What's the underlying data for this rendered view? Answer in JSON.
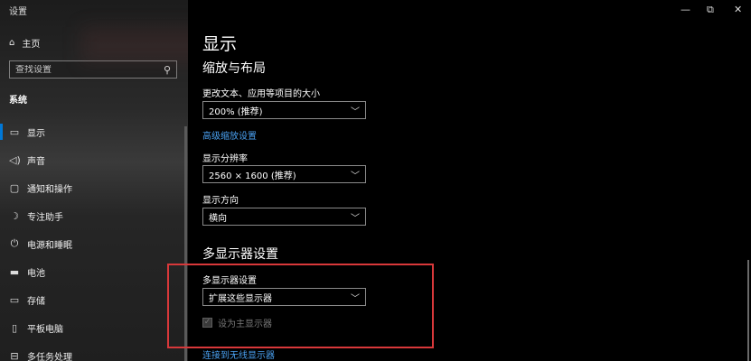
{
  "app": {
    "title": "设置",
    "home": "主页"
  },
  "search": {
    "placeholder": "查找设置"
  },
  "sidebar": {
    "section": "系统",
    "items": [
      {
        "icon": "monitor-icon",
        "label": "显示"
      },
      {
        "icon": "speaker-icon",
        "label": "声音"
      },
      {
        "icon": "notification-icon",
        "label": "通知和操作"
      },
      {
        "icon": "moon-icon",
        "label": "专注助手"
      },
      {
        "icon": "power-icon",
        "label": "电源和睡眠"
      },
      {
        "icon": "battery-icon",
        "label": "电池"
      },
      {
        "icon": "storage-icon",
        "label": "存储"
      },
      {
        "icon": "tablet-icon",
        "label": "平板电脑"
      },
      {
        "icon": "multitask-icon",
        "label": "多任务处理"
      }
    ]
  },
  "window": {
    "minimize": "—",
    "restore": "⧉",
    "close": "✕"
  },
  "main": {
    "title": "显示",
    "scale_section": "缩放与布局",
    "text_size_label": "更改文本、应用等项目的大小",
    "text_size_value": "200% (推荐)",
    "advanced_link": "高级缩放设置",
    "resolution_label": "显示分辨率",
    "resolution_value": "2560 × 1600 (推荐)",
    "orientation_label": "显示方向",
    "orientation_value": "横向",
    "multi_section": "多显示器设置",
    "multi_label": "多显示器设置",
    "multi_value": "扩展这些显示器",
    "primary_checkbox": "设为主显示器",
    "wireless_link": "连接到无线显示器"
  },
  "colors": {
    "accent": "#0078d7",
    "link": "#4aa0f0",
    "highlight": "#d8383a"
  }
}
